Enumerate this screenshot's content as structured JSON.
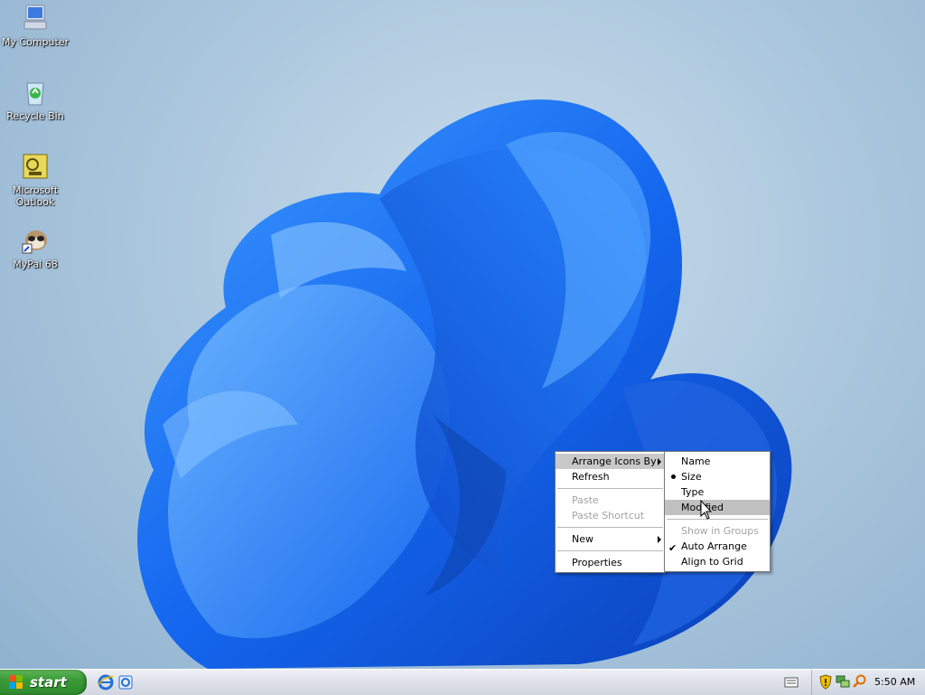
{
  "desktop": {
    "icons": [
      {
        "label": "My Computer",
        "icon": "my-computer-icon"
      },
      {
        "label": "Recycle Bin",
        "icon": "recycle-bin-icon"
      },
      {
        "label": "Microsoft Outlook",
        "icon": "outlook-icon"
      },
      {
        "label": "MyPal 68",
        "icon": "mypal-icon"
      }
    ]
  },
  "context_menu": {
    "items": [
      {
        "label": "Arrange Icons By",
        "submenu": true,
        "state": "open"
      },
      {
        "label": "Refresh"
      },
      {
        "label": "Paste",
        "disabled": true
      },
      {
        "label": "Paste Shortcut",
        "disabled": true
      },
      {
        "label": "New",
        "submenu": true
      },
      {
        "label": "Properties"
      }
    ]
  },
  "arrange_submenu": {
    "items": [
      {
        "label": "Name"
      },
      {
        "label": "Size",
        "selected": true
      },
      {
        "label": "Type"
      },
      {
        "label": "Modified",
        "highlighted": true
      },
      {
        "label": "Show in Groups",
        "disabled": true
      },
      {
        "label": "Auto Arrange",
        "checked": true
      },
      {
        "label": "Align to Grid"
      }
    ]
  },
  "taskbar": {
    "start_label": "start",
    "quick_launch": [
      "internet-explorer-icon",
      "ie-alt-icon"
    ],
    "tray_icons": [
      "keyboard-icon",
      "security-shield-icon",
      "network-icon",
      "search-icon"
    ],
    "clock": "5:50 AM"
  },
  "colors": {
    "wallpaper_blue": "#1a73e8",
    "start_green": "#3a9a36",
    "menu_highlight": "#c0c0c0"
  }
}
